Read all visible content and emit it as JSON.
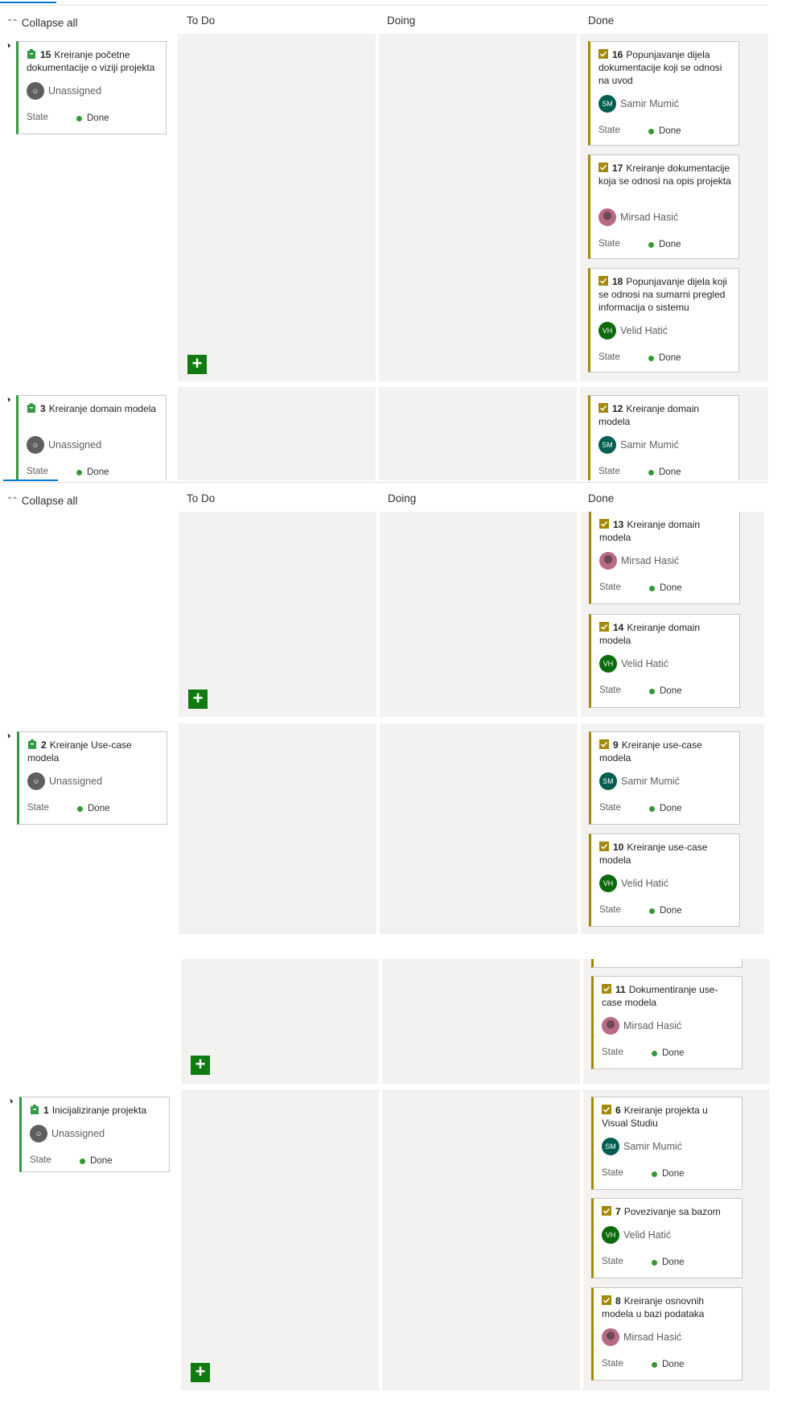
{
  "board": {
    "collapse_label": "Collapse all",
    "columns": [
      "To Do",
      "Doing",
      "Done"
    ],
    "state_label": "State",
    "state_value": "Done"
  },
  "rows": [
    {
      "parent": {
        "id": "15",
        "title": "Kreiranje početne dokumentacije o viziji projekta",
        "assignee": "Unassigned",
        "state": "Done"
      },
      "tasks": [
        {
          "id": "16",
          "title": "Popunjavanje dijela dokumentacije koji se odnosi na uvod",
          "assignee": "Samir Mumić",
          "initials": "SM",
          "state": "Done"
        },
        {
          "id": "17",
          "title": "Kreiranje dokumentacije koja se odnosi na opis projekta",
          "assignee": "Mirsad Hasić",
          "initials": "",
          "state": "Done"
        },
        {
          "id": "18",
          "title": "Popunjavanje dijela koji se odnosi na sumarni pregled informacija o sistemu",
          "assignee": "Velid Hatić",
          "initials": "VH",
          "state": "Done"
        }
      ]
    },
    {
      "parent": {
        "id": "3",
        "title": "Kreiranje domain modela",
        "assignee": "Unassigned",
        "state": "Done"
      },
      "tasks": [
        {
          "id": "12",
          "title": "Kreiranje domain modela",
          "assignee": "Samir Mumić",
          "initials": "SM",
          "state": "Done"
        },
        {
          "id": "13",
          "title": "Kreiranje domain modela",
          "assignee": "Mirsad Hasić",
          "initials": "",
          "state": "Done"
        },
        {
          "id": "14",
          "title": "Kreiranje domain modela",
          "assignee": "Velid Hatić",
          "initials": "VH",
          "state": "Done"
        }
      ]
    },
    {
      "parent": {
        "id": "2",
        "title": "Kreiranje Use-case modela",
        "assignee": "Unassigned",
        "state": "Done"
      },
      "tasks": [
        {
          "id": "9",
          "title": "Kreiranje use-case modela",
          "assignee": "Samir Mumić",
          "initials": "SM",
          "state": "Done"
        },
        {
          "id": "10",
          "title": "Kreiranje use-case modela",
          "assignee": "Velid Hatić",
          "initials": "VH",
          "state": "Done"
        },
        {
          "id": "11",
          "title": "Dokumentiranje use-case modela",
          "assignee": "Mirsad Hasić",
          "initials": "",
          "state": "Done"
        }
      ]
    },
    {
      "parent": {
        "id": "1",
        "title": "Inicijaliziranje projekta",
        "assignee": "Unassigned",
        "state": "Done"
      },
      "tasks": [
        {
          "id": "6",
          "title": "Kreiranje projekta u Visual Studiu",
          "assignee": "Samir Mumić",
          "initials": "SM",
          "state": "Done"
        },
        {
          "id": "7",
          "title": "Povezivanje sa bazom",
          "assignee": "Velid Hatić",
          "initials": "VH",
          "state": "Done"
        },
        {
          "id": "8",
          "title": "Kreiranje osnovnih modela u bazi podataka",
          "assignee": "Mirsad Hasić",
          "initials": "",
          "state": "Done"
        }
      ]
    }
  ]
}
